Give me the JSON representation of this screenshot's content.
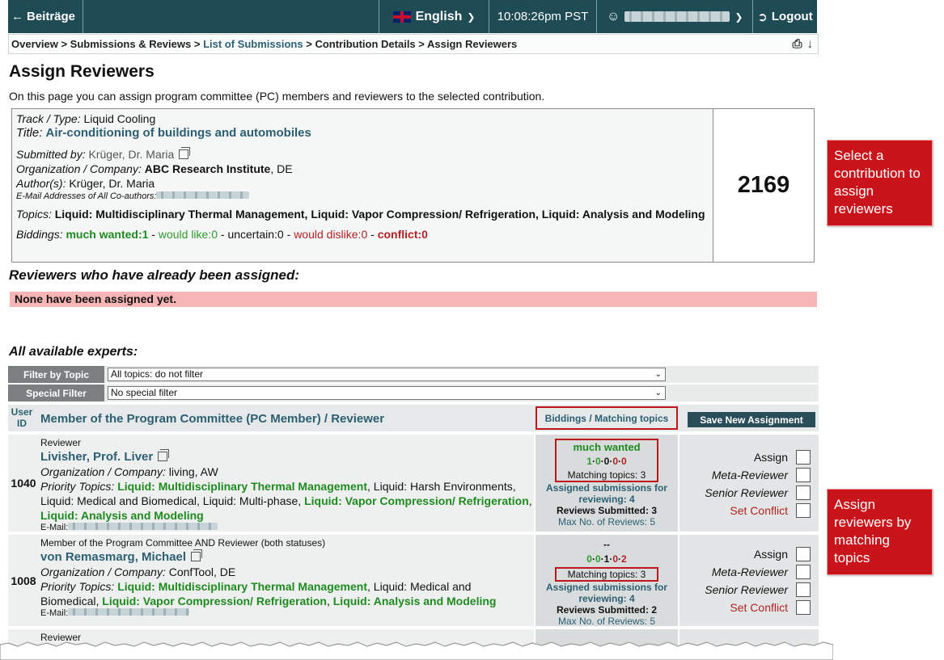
{
  "topbar": {
    "back_label": "Beiträge",
    "language": "English",
    "time": "10:08:26pm PST",
    "logout": "Logout"
  },
  "breadcrumb": {
    "overview": "Overview",
    "submissions": "Submissions & Reviews",
    "list": "List of Submissions",
    "details": "Contribution Details",
    "current": "Assign Reviewers",
    "sep": ">"
  },
  "page": {
    "title": "Assign Reviewers",
    "intro": "On this page you can assign program committee (PC) members and reviewers to the selected contribution."
  },
  "contribution": {
    "track_label": "Track / Type:",
    "track": "Liquid Cooling",
    "title_label": "Title:",
    "title": "Air-conditioning of buildings and automobiles",
    "submitted_label": "Submitted by:",
    "submitted_by": "Krüger, Dr. Maria",
    "org_label": "Organization / Company:",
    "org": "ABC Research Institute",
    "org_country": ", DE",
    "authors_label": "Author(s):",
    "authors": "Krüger, Dr. Maria",
    "emails_label": "E-Mail Addresses of All Co-authors:",
    "topics_label": "Topics:",
    "topics": "Liquid: Multidisciplinary Thermal Management, Liquid: Vapor Compression/ Refrigeration, Liquid: Analysis and Modeling",
    "biddings_label": "Biddings:",
    "bid_much_wanted": "much wanted:1",
    "bid_would_like": "would like:0",
    "bid_uncertain": "uncertain:0",
    "bid_would_dislike": "would dislike:0",
    "bid_conflict": "conflict:0",
    "bid_sep": " - ",
    "id": "2169"
  },
  "assigned": {
    "heading": "Reviewers who have already been assigned:",
    "none": "None have been assigned yet."
  },
  "experts": {
    "heading": "All available experts:",
    "filter_topic_label": "Filter by Topic",
    "filter_topic_value": "All topics: do not filter",
    "special_filter_label": "Special Filter",
    "special_filter_value": "No special filter",
    "col_user_id": "User ID",
    "col_member": "Member of the Program Committee (PC Member) / Reviewer",
    "col_biddings": "Biddings / Matching topics",
    "save_button": "Save New Assignment",
    "assign_labels": {
      "assign": "Assign",
      "meta": "Meta-Reviewer",
      "senior": "Senior Reviewer",
      "conflict": "Set Conflict"
    },
    "rows": [
      {
        "uid": "1040",
        "role": "Reviewer",
        "name": "Livisher, Prof. Liver",
        "org_label": "Organization / Company:",
        "org": "living, AW",
        "priority_label": "Priority Topics:",
        "pt1": "Liquid: Multidisciplinary Thermal Management",
        "pt2": ", Liquid: Harsh Environments, Liquid: Medical and Biomedical, Liquid: Multi-phase, ",
        "pt3": "Liquid: Vapor Compression/ Refrigeration",
        "pt4": ", ",
        "pt5": "Liquid: Analysis and Modeling",
        "email_label": "E-Mail:",
        "bid_text": "much wanted",
        "bid_counts": [
          "1",
          "0",
          "0",
          "0",
          "0"
        ],
        "matching": "Matching topics: 3",
        "assigned_subs": "Assigned submissions for reviewing: 4",
        "reviews_submitted": "Reviews Submitted: 3",
        "max_reviews": "Max No. of Reviews: 5"
      },
      {
        "uid": "1008",
        "role": "Member of the Program Committee AND Reviewer (both statuses)",
        "name": "von Remasmarg, Michael",
        "org_label": "Organization / Company:",
        "org": "ConfTool, DE",
        "priority_label": "Priority Topics:",
        "pt1": "Liquid: Multidisciplinary Thermal Management",
        "pt2": ", Liquid: Medical and Biomedical, ",
        "pt3": "Liquid: Vapor Compression/ Refrigeration",
        "pt4": ", ",
        "pt5": "Liquid: Analysis and Modeling",
        "email_label": "E-Mail:",
        "bid_text": "--",
        "bid_counts": [
          "0",
          "0",
          "1",
          "0",
          "2"
        ],
        "matching": "Matching topics: 3",
        "assigned_subs": "Assigned submissions for reviewing: 4",
        "reviews_submitted": "Reviews Submitted: 2",
        "max_reviews": "Max No. of Reviews: 5"
      },
      {
        "role": "Reviewer"
      }
    ]
  },
  "callouts": {
    "select": "Select a contribution to assign reviewers",
    "assign": "Assign reviewers by matching topics"
  },
  "colors": {
    "topbar": "#1f4b55",
    "accent_red": "#c8141a",
    "link_teal": "#2c5f72",
    "green": "#1f8a1f"
  }
}
